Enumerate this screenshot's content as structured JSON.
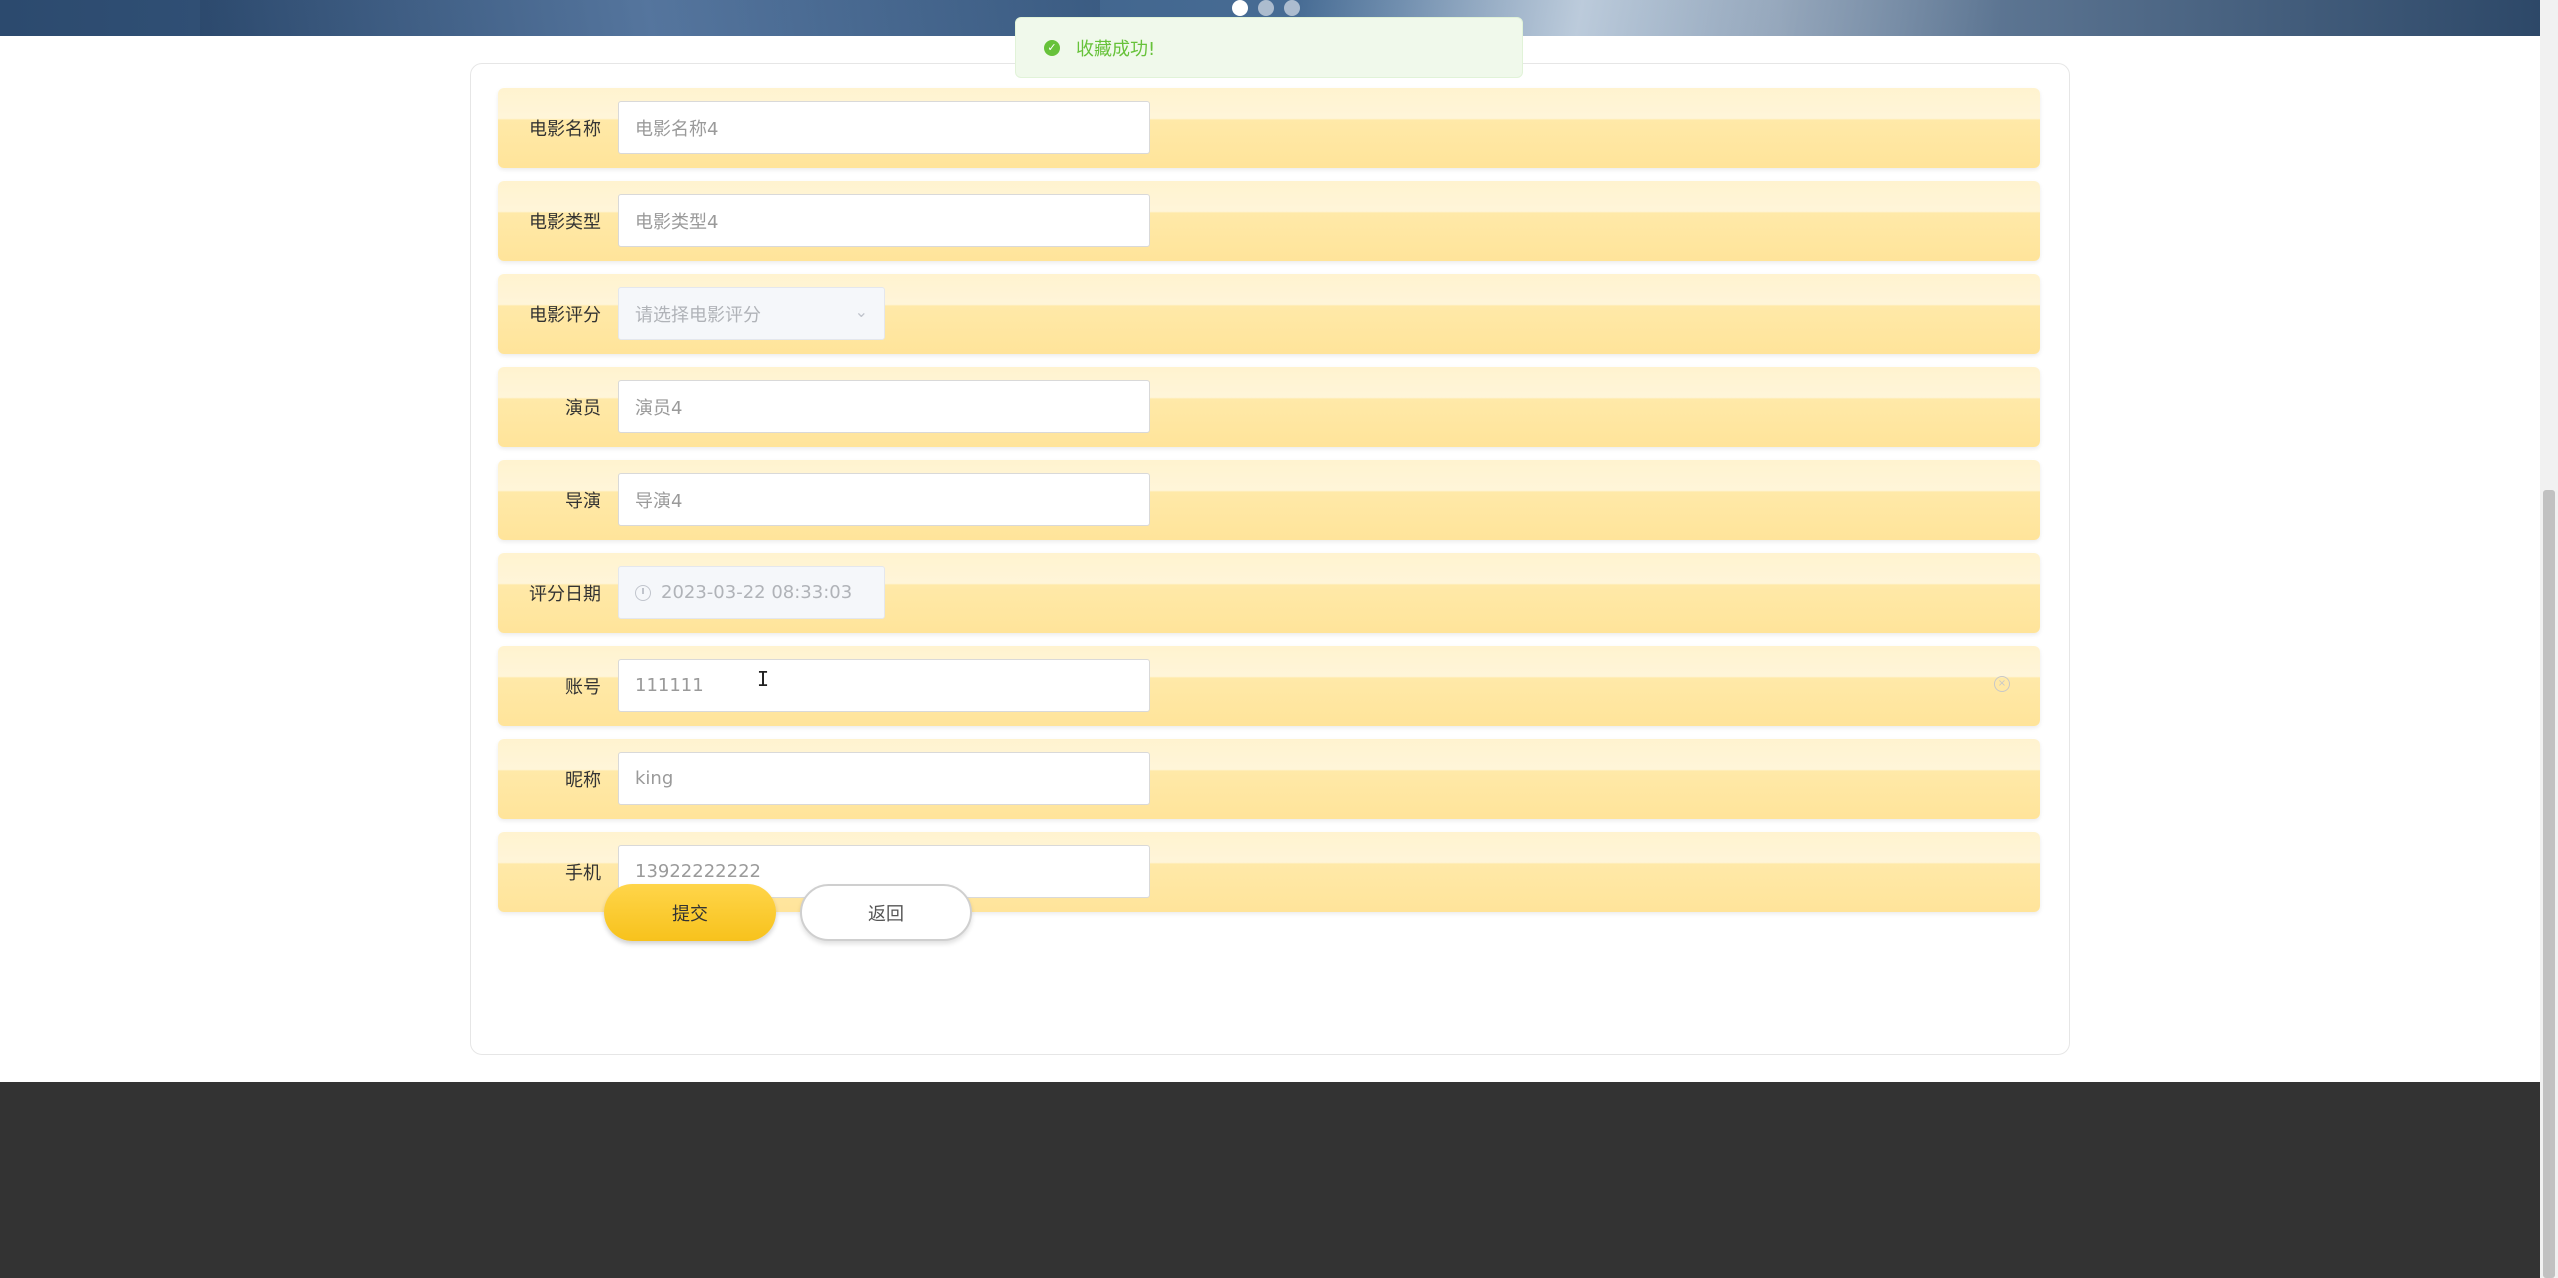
{
  "toast": {
    "message": "收藏成功!"
  },
  "form": {
    "fields": [
      {
        "label": "电影名称",
        "value": "电影名称4"
      },
      {
        "label": "电影类型",
        "value": "电影类型4"
      },
      {
        "label": "电影评分",
        "placeholder": "请选择电影评分"
      },
      {
        "label": "演员",
        "value": "演员4"
      },
      {
        "label": "导演",
        "value": "导演4"
      },
      {
        "label": "评分日期",
        "value": "2023-03-22 08:33:03"
      },
      {
        "label": "账号",
        "value": "111111"
      },
      {
        "label": "昵称",
        "value": "king"
      },
      {
        "label": "手机",
        "value": "13922222222"
      }
    ],
    "submit_label": "提交",
    "back_label": "返回"
  },
  "icons": {
    "success": "check-circle-icon",
    "select": "chevron-down-icon",
    "date": "clock-icon",
    "clear": "circle-close-icon"
  },
  "colors": {
    "accent": "#f7c21c",
    "row_background": "#ffe9a8",
    "toast_text": "#67c23a",
    "footer": "#333333"
  }
}
